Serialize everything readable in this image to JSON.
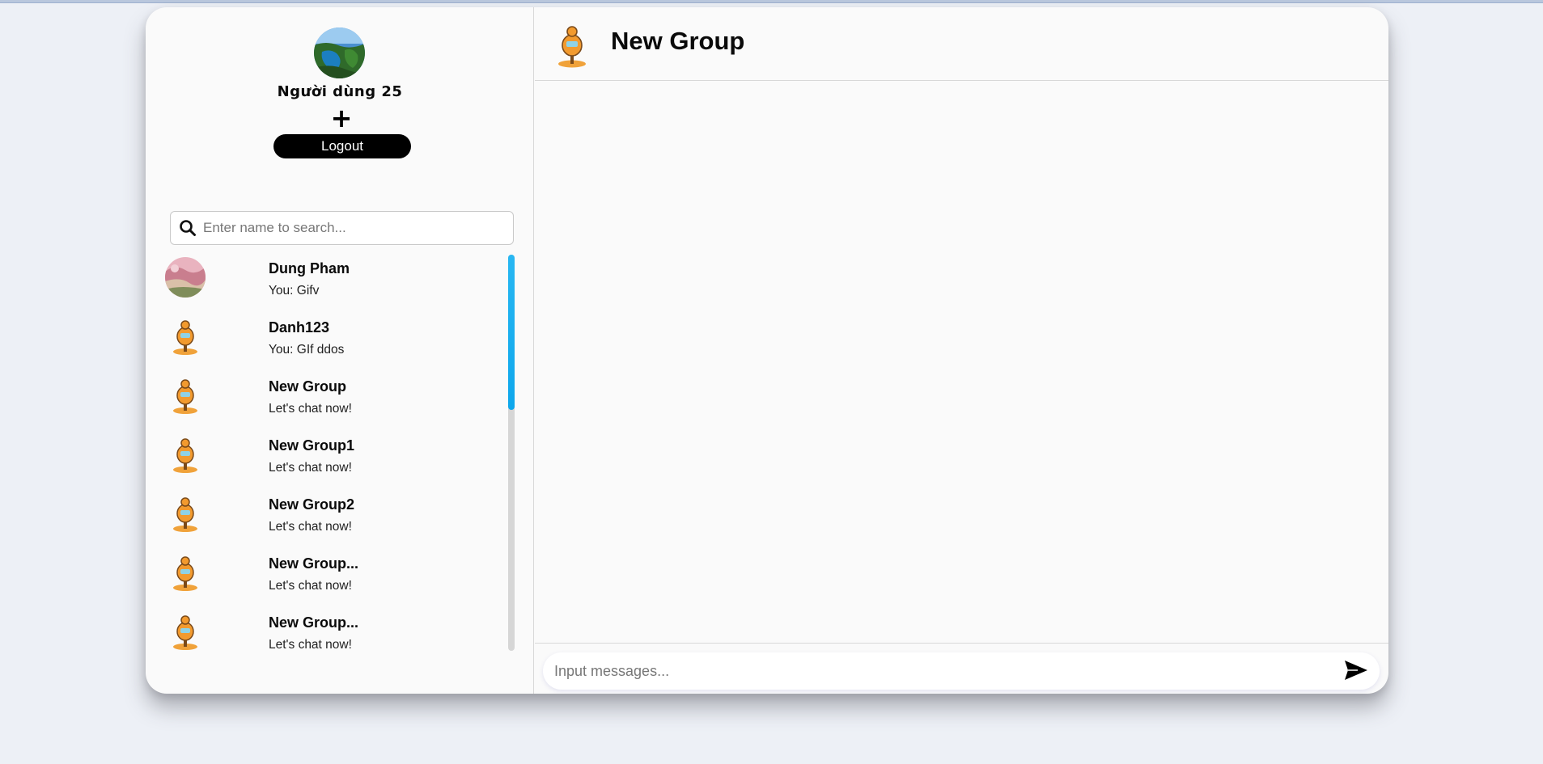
{
  "profile": {
    "username": "Người dùng 25",
    "add_label": "+",
    "logout_label": "Logout"
  },
  "search": {
    "placeholder": "Enter name to search..."
  },
  "conversations": [
    {
      "name": "Dung Pham",
      "preview": "You: Gifv",
      "avatar": "landscape-photo"
    },
    {
      "name": "Danh123",
      "preview": "You: GIf ddos",
      "avatar": "mascot-icon"
    },
    {
      "name": "New Group",
      "preview": "Let's chat now!",
      "avatar": "mascot-icon"
    },
    {
      "name": "New Group1",
      "preview": "Let's chat now!",
      "avatar": "mascot-icon"
    },
    {
      "name": "New Group2",
      "preview": "Let's chat now!",
      "avatar": "mascot-icon"
    },
    {
      "name": "New Group...",
      "preview": "Let's chat now!",
      "avatar": "mascot-icon"
    },
    {
      "name": "New Group...",
      "preview": "Let's chat now!",
      "avatar": "mascot-icon"
    }
  ],
  "chat": {
    "title": "New Group",
    "input_placeholder": "Input messages..."
  },
  "colors": {
    "accent": "#0ea7ec",
    "logout_bg": "#000000",
    "background": "#edf0f6",
    "panel": "#fafafa"
  }
}
